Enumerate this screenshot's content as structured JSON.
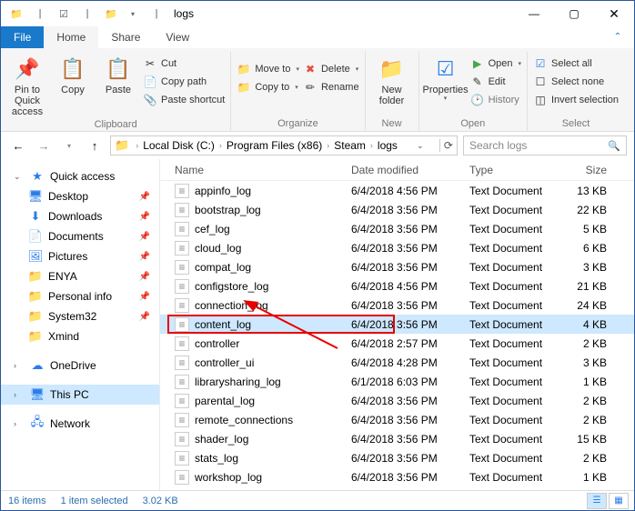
{
  "title": "logs",
  "tabs": {
    "file": "File",
    "home": "Home",
    "share": "Share",
    "view": "View"
  },
  "ribbon": {
    "clipboard": {
      "label": "Clipboard",
      "pin": "Pin to Quick\naccess",
      "copy": "Copy",
      "paste": "Paste",
      "cut": "Cut",
      "copy_path": "Copy path",
      "paste_shortcut": "Paste shortcut"
    },
    "organize": {
      "label": "Organize",
      "move_to": "Move to",
      "copy_to": "Copy to",
      "delete": "Delete",
      "rename": "Rename"
    },
    "new": {
      "label": "New",
      "new_folder": "New\nfolder"
    },
    "open": {
      "label": "Open",
      "properties": "Properties",
      "open": "Open",
      "edit": "Edit",
      "history": "History"
    },
    "select": {
      "label": "Select",
      "select_all": "Select all",
      "select_none": "Select none",
      "invert": "Invert selection"
    }
  },
  "breadcrumb": [
    "Local Disk (C:)",
    "Program Files (x86)",
    "Steam",
    "logs"
  ],
  "search_placeholder": "Search logs",
  "sidebar": {
    "quick_access": "Quick access",
    "items": [
      {
        "label": "Desktop",
        "pinned": true
      },
      {
        "label": "Downloads",
        "pinned": true
      },
      {
        "label": "Documents",
        "pinned": true
      },
      {
        "label": "Pictures",
        "pinned": true
      },
      {
        "label": "ENYA",
        "pinned": true
      },
      {
        "label": "Personal info",
        "pinned": true
      },
      {
        "label": "System32",
        "pinned": true
      },
      {
        "label": "Xmind",
        "pinned": false
      }
    ],
    "onedrive": "OneDrive",
    "this_pc": "This PC",
    "network": "Network"
  },
  "columns": {
    "name": "Name",
    "date": "Date modified",
    "type": "Type",
    "size": "Size"
  },
  "files": [
    {
      "name": "appinfo_log",
      "date": "6/4/2018 4:56 PM",
      "type": "Text Document",
      "size": "13 KB"
    },
    {
      "name": "bootstrap_log",
      "date": "6/4/2018 3:56 PM",
      "type": "Text Document",
      "size": "22 KB"
    },
    {
      "name": "cef_log",
      "date": "6/4/2018 3:56 PM",
      "type": "Text Document",
      "size": "5 KB"
    },
    {
      "name": "cloud_log",
      "date": "6/4/2018 3:56 PM",
      "type": "Text Document",
      "size": "6 KB"
    },
    {
      "name": "compat_log",
      "date": "6/4/2018 3:56 PM",
      "type": "Text Document",
      "size": "3 KB"
    },
    {
      "name": "configstore_log",
      "date": "6/4/2018 4:56 PM",
      "type": "Text Document",
      "size": "21 KB"
    },
    {
      "name": "connection_log",
      "date": "6/4/2018 3:56 PM",
      "type": "Text Document",
      "size": "24 KB"
    },
    {
      "name": "content_log",
      "date": "6/4/2018 3:56 PM",
      "type": "Text Document",
      "size": "4 KB",
      "selected": true,
      "highlight": true
    },
    {
      "name": "controller",
      "date": "6/4/2018 2:57 PM",
      "type": "Text Document",
      "size": "2 KB"
    },
    {
      "name": "controller_ui",
      "date": "6/4/2018 4:28 PM",
      "type": "Text Document",
      "size": "3 KB"
    },
    {
      "name": "librarysharing_log",
      "date": "6/1/2018 6:03 PM",
      "type": "Text Document",
      "size": "1 KB"
    },
    {
      "name": "parental_log",
      "date": "6/4/2018 3:56 PM",
      "type": "Text Document",
      "size": "2 KB"
    },
    {
      "name": "remote_connections",
      "date": "6/4/2018 3:56 PM",
      "type": "Text Document",
      "size": "2 KB"
    },
    {
      "name": "shader_log",
      "date": "6/4/2018 3:56 PM",
      "type": "Text Document",
      "size": "15 KB"
    },
    {
      "name": "stats_log",
      "date": "6/4/2018 3:56 PM",
      "type": "Text Document",
      "size": "2 KB"
    },
    {
      "name": "workshop_log",
      "date": "6/4/2018 3:56 PM",
      "type": "Text Document",
      "size": "1 KB"
    }
  ],
  "status": {
    "count": "16 items",
    "selected": "1 item selected",
    "size": "3.02 KB"
  }
}
